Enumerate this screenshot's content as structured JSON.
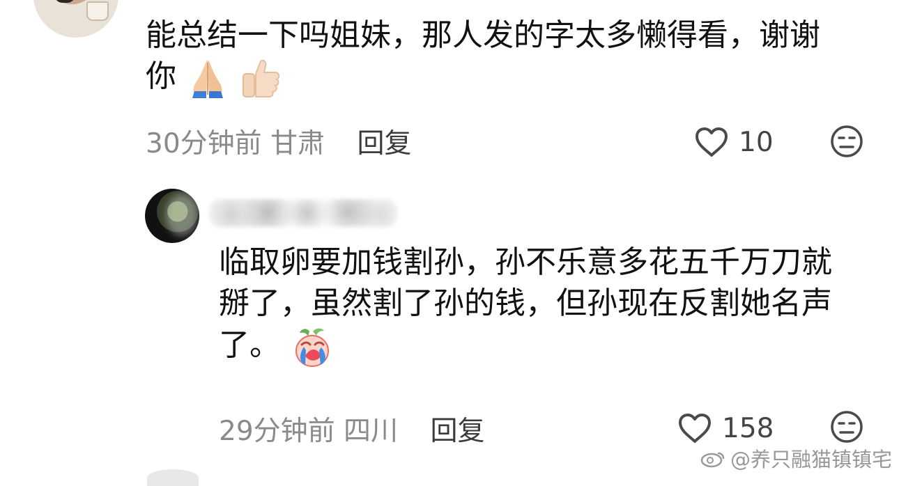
{
  "comment_1": {
    "text": "能总结一下吗姐妹，那人发的字太多懒得看，谢谢你",
    "emoji_1": "folded-hands",
    "emoji_2": "thumbs-up",
    "time": "30分钟前",
    "location": "甘肃",
    "reply_label": "回复",
    "likes": "10",
    "like_icon": "heart-outline-icon",
    "reaction_icon": "neutral-face-icon"
  },
  "comment_2": {
    "text": "临取卵要加钱割孙，孙不乐意多花五千万刀就掰了，虽然割了孙的钱，但孙现在反割她名声了。",
    "emoji": "crying-peach",
    "time": "29分钟前",
    "location": "四川",
    "reply_label": "回复",
    "likes": "158",
    "like_icon": "heart-outline-icon",
    "reaction_icon": "neutral-face-icon"
  },
  "watermark": "@养只融猫镇镇宅",
  "colors": {
    "meta_gray": "#8a8a8a",
    "text": "#111111",
    "icon": "#4a4a4a"
  }
}
